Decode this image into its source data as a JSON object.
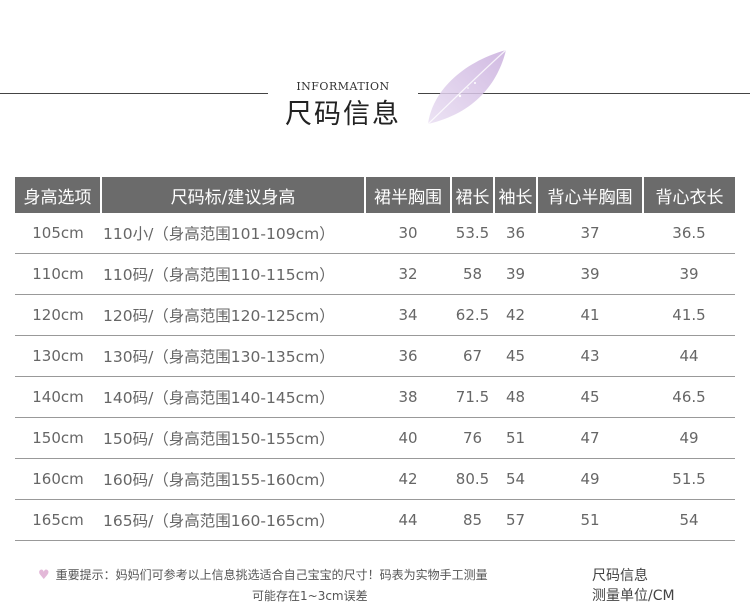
{
  "header": {
    "subtitle_en": "INFORMATION",
    "title_cn": "尺码信息"
  },
  "table": {
    "columns": [
      "身高选项",
      "尺码标/建议身高",
      "裙半胸围",
      "裙长",
      "袖长",
      "背心半胸围",
      "背心衣长"
    ],
    "rows": [
      [
        "105cm",
        "110小/（身高范围101-109cm）",
        "30",
        "53.5",
        "36",
        "37",
        "36.5"
      ],
      [
        "110cm",
        "110码/（身高范围110-115cm）",
        "32",
        "58",
        "39",
        "39",
        "39"
      ],
      [
        "120cm",
        "120码/（身高范围120-125cm）",
        "34",
        "62.5",
        "42",
        "41",
        "41.5"
      ],
      [
        "130cm",
        "130码/（身高范围130-135cm）",
        "36",
        "67",
        "45",
        "43",
        "44"
      ],
      [
        "140cm",
        "140码/（身高范围140-145cm）",
        "38",
        "71.5",
        "48",
        "45",
        "46.5"
      ],
      [
        "150cm",
        "150码/（身高范围150-155cm）",
        "40",
        "76",
        "51",
        "47",
        "49"
      ],
      [
        "160cm",
        "160码/（身高范围155-160cm）",
        "42",
        "80.5",
        "54",
        "49",
        "51.5"
      ],
      [
        "165cm",
        "165码/（身高范围160-165cm）",
        "44",
        "85",
        "57",
        "51",
        "54"
      ]
    ]
  },
  "footer": {
    "heart_icon": "heart-icon",
    "note_line1": "重要提示：妈妈们可参考以上信息挑选适合自己宝宝的尺寸！码表为实物手工测量",
    "note_line2": "可能存在1~3cm误差",
    "right_line1": "尺码信息",
    "right_line2": "测量单位/CM"
  },
  "colors": {
    "header_bg": "#6b6b6b",
    "leaf": "#d9c6e6",
    "heart": "#e3b8d8"
  }
}
